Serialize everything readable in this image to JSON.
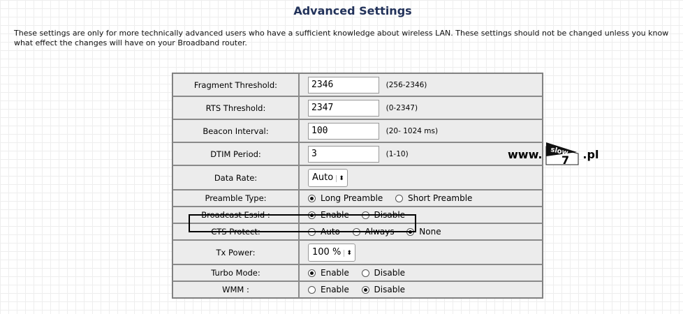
{
  "page": {
    "title": "Advanced Settings",
    "intro": "These settings are only for more technically advanced users who have a sufficient knowledge about wireless LAN. These settings should not be changed unless you know what effect the changes will have on your Broadband router."
  },
  "rows": {
    "fragment": {
      "label": "Fragment Threshold:",
      "value": "2346",
      "hint": "(256-2346)"
    },
    "rts": {
      "label": "RTS Threshold:",
      "value": "2347",
      "hint": "(0-2347)"
    },
    "beacon": {
      "label": "Beacon Interval:",
      "value": "100",
      "hint": "(20- 1024 ms)"
    },
    "dtim": {
      "label": "DTIM Period:",
      "value": "3",
      "hint": "(1-10)"
    },
    "datarate": {
      "label": "Data Rate:",
      "selected": "Auto"
    },
    "preamble": {
      "label": "Preamble Type:",
      "options": [
        "Long Preamble",
        "Short Preamble"
      ],
      "selected": "Long Preamble"
    },
    "essid": {
      "label": "Broadcast Essid :",
      "options": [
        "Enable",
        "Disable"
      ],
      "selected": "Enable"
    },
    "cts": {
      "label": "CTS Protect:",
      "options": [
        "Auto",
        "Always",
        "None"
      ],
      "selected": "None"
    },
    "txpower": {
      "label": "Tx Power:",
      "selected": "100 %"
    },
    "turbo": {
      "label": "Turbo Mode:",
      "options": [
        "Enable",
        "Disable"
      ],
      "selected": "Enable"
    },
    "wmm": {
      "label": "WMM :",
      "options": [
        "Enable",
        "Disable"
      ],
      "selected": "Disable"
    }
  },
  "watermark": {
    "prefix": "www.",
    "logo_top": "slow",
    "logo_bottom": "7",
    "suffix": ".pl"
  }
}
